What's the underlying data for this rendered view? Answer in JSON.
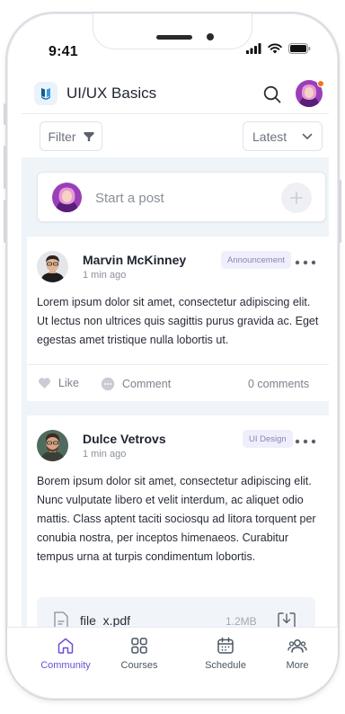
{
  "status_bar": {
    "time": "9:41"
  },
  "header": {
    "title": "UI/UX Basics"
  },
  "filter_bar": {
    "filter_label": "Filter",
    "sort_label": "Latest"
  },
  "composer": {
    "placeholder": "Start a post"
  },
  "posts": [
    {
      "author": "Marvin McKinney",
      "time": "1 min ago",
      "tag": "Announcement",
      "body": "Lorem ipsum dolor sit amet, consectetur adipiscing elit. Ut lectus non ultrices quis sagittis purus gravida ac. Eget egestas amet tristique nulla lobortis ut.",
      "like_label": "Like",
      "comment_label": "Comment",
      "comments_count": "0 comments"
    },
    {
      "author": "Dulce Vetrovs",
      "time": "1 min ago",
      "tag": "UI Design",
      "body": "Borem ipsum dolor sit amet, consectetur adipiscing elit. Nunc vulputate libero et velit interdum, ac aliquet odio mattis. Class aptent taciti sociosqu ad litora torquent per conubia nostra, per inceptos himenaeos. Curabitur tempus urna at turpis condimentum lobortis.",
      "attachment": {
        "name": "file_x.pdf",
        "size": "1.2MB"
      }
    }
  ],
  "bottom_nav": [
    {
      "label": "Community",
      "icon": "home-icon",
      "active": true
    },
    {
      "label": "Courses",
      "icon": "grid-icon",
      "active": false
    },
    {
      "label": "Schedule",
      "icon": "calendar-icon",
      "active": false
    },
    {
      "label": "More",
      "icon": "users-icon",
      "active": false
    }
  ],
  "colors": {
    "accent": "#6d4fd6",
    "tag_bg": "#efeefb",
    "feed_bg": "#eef4f8",
    "notification_dot": "#f97316"
  }
}
